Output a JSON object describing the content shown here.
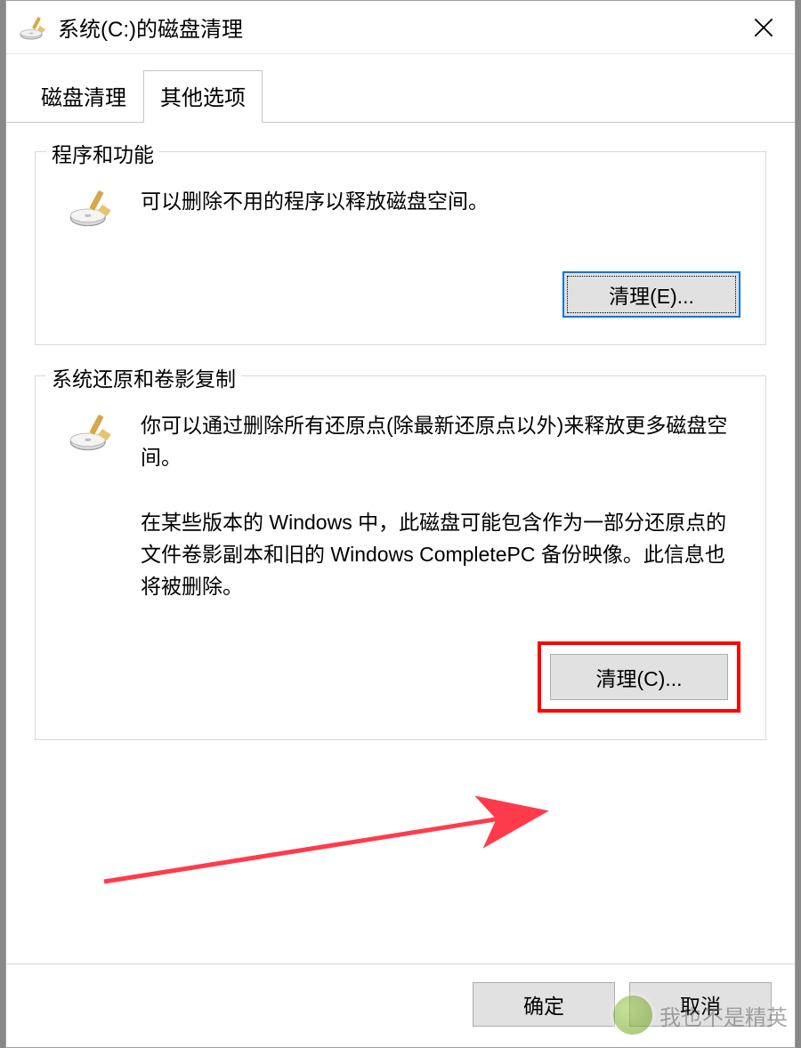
{
  "titlebar": {
    "title": "系统(C:)的磁盘清理"
  },
  "tabs": [
    {
      "label": "磁盘清理",
      "active": false
    },
    {
      "label": "其他选项",
      "active": true
    }
  ],
  "group1": {
    "legend": "程序和功能",
    "text": "可以删除不用的程序以释放磁盘空间。",
    "button": "清理(E)..."
  },
  "group2": {
    "legend": "系统还原和卷影复制",
    "text1": "你可以通过删除所有还原点(除最新还原点以外)来释放更多磁盘空间。",
    "text2": "在某些版本的 Windows 中，此磁盘可能包含作为一部分还原点的文件卷影副本和旧的 Windows CompletePC 备份映像。此信息也将被删除。",
    "button": "清理(C)..."
  },
  "footer": {
    "ok": "确定",
    "cancel": "取消"
  },
  "watermark": {
    "text": "我也不是精英"
  }
}
